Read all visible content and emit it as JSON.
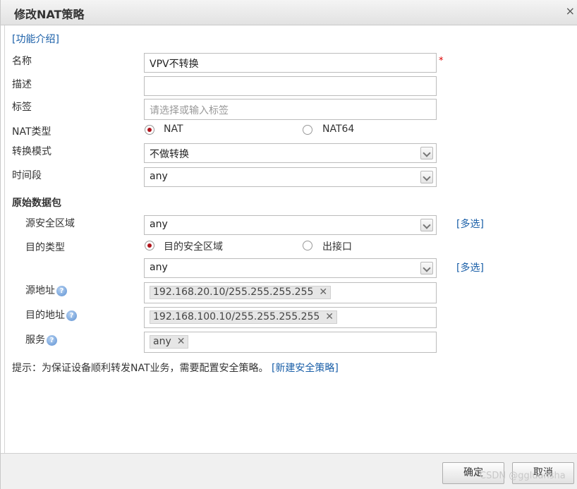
{
  "dialog": {
    "title": "修改NAT策略",
    "close_label": "×"
  },
  "intro_link": "[功能介绍]",
  "form": {
    "name": {
      "label": "名称",
      "value": "VPV不转换",
      "required_mark": "*"
    },
    "description": {
      "label": "描述",
      "value": ""
    },
    "tags": {
      "label": "标签",
      "placeholder": "请选择或输入标签"
    },
    "nat_type": {
      "label": "NAT类型",
      "options": [
        "NAT",
        "NAT64"
      ],
      "selected": "NAT"
    },
    "convert_mode": {
      "label": "转换模式",
      "value": "不做转换"
    },
    "time_range": {
      "label": "时间段",
      "value": "any"
    }
  },
  "original_packet": {
    "section_title": "原始数据包",
    "source_zone": {
      "label": "源安全区域",
      "value": "any",
      "multi_label": "[多选]"
    },
    "dest_type": {
      "label": "目的类型",
      "options": [
        "目的安全区域",
        "出接口"
      ],
      "selected": "目的安全区域"
    },
    "dest_zone": {
      "value": "any",
      "multi_label": "[多选]"
    },
    "source_address": {
      "label": "源地址",
      "tags": [
        "192.168.20.10/255.255.255.255"
      ]
    },
    "dest_address": {
      "label": "目的地址",
      "tags": [
        "192.168.100.10/255.255.255.255"
      ]
    },
    "service": {
      "label": "服务",
      "tags": [
        "any"
      ]
    }
  },
  "hint": {
    "text": "提示：为保证设备顺利转发NAT业务，需要配置安全策略。",
    "link": "[新建安全策略]"
  },
  "footer": {
    "ok_label": "确定",
    "cancel_label": "取消"
  },
  "watermark": "CSDN @ggluansha",
  "colors": {
    "link": "#1a5fa8",
    "radio_checked": "#b0141c",
    "required": "#dd0000"
  },
  "icons": {
    "help": "question-circle-icon",
    "close": "close-icon",
    "dropdown": "chevron-down-icon",
    "remove": "x-icon"
  }
}
